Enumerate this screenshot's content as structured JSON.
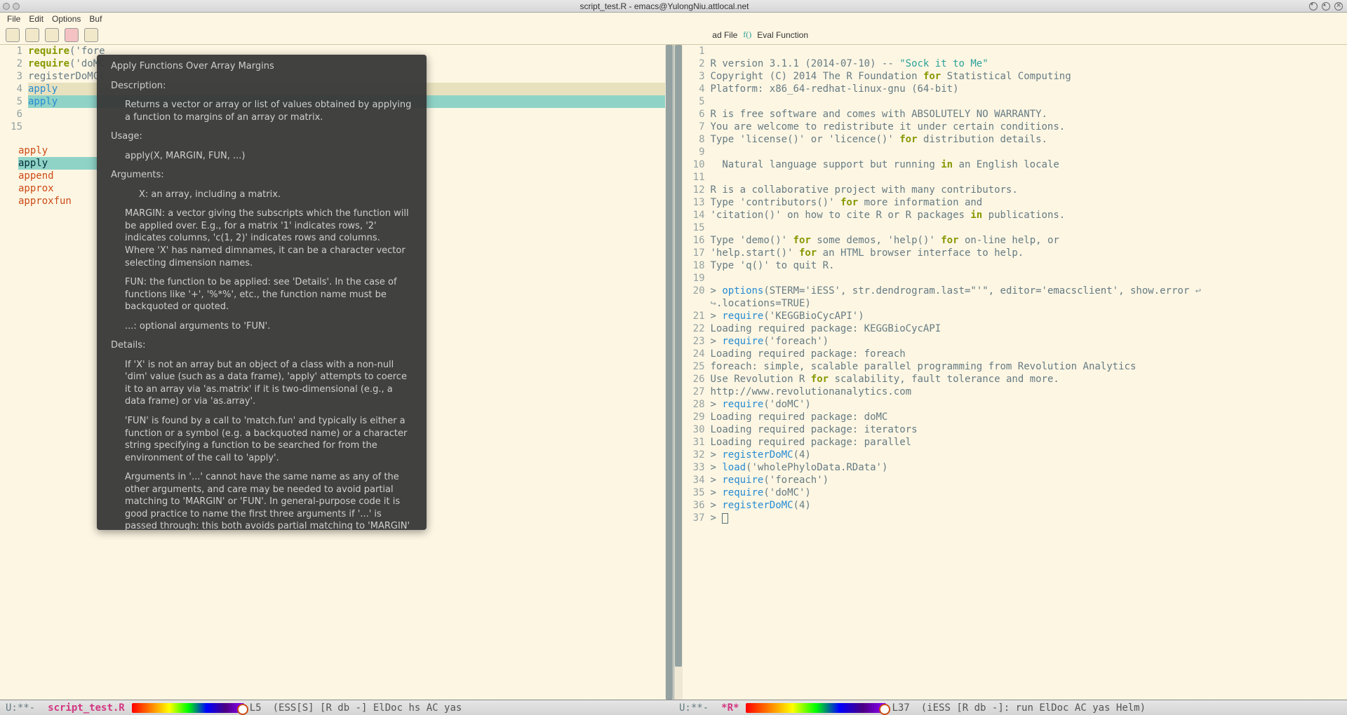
{
  "titlebar": {
    "title": "script_test.R - emacs@YulongNiu.attlocal.net"
  },
  "menu": {
    "items": [
      "File",
      "Edit",
      "Options",
      "Buf"
    ]
  },
  "toolbar": {
    "load_file": "ad File",
    "eval_function": "Eval Function"
  },
  "left": {
    "gutter": [
      "1",
      "2",
      "3",
      "4",
      "5",
      "6",
      "15"
    ],
    "lines": [
      {
        "raw": [
          {
            "t": "require",
            "c": "kw"
          },
          {
            "t": "('fore",
            "c": ""
          }
        ]
      },
      {
        "raw": [
          {
            "t": "require",
            "c": "kw"
          },
          {
            "t": "('doMC",
            "c": ""
          }
        ]
      },
      {
        "raw": [
          {
            "t": "registerDoMC(",
            "c": ""
          }
        ]
      },
      {
        "raw": [
          {
            "t": "",
            "c": ""
          }
        ]
      },
      {
        "raw": [
          {
            "t": "apply",
            "c": "kw2"
          }
        ],
        "hl": true
      },
      {
        "raw": [
          {
            "t": "apply",
            "c": "kw2"
          }
        ],
        "sel": true
      }
    ]
  },
  "completion": {
    "items": [
      {
        "label": "apply"
      },
      {
        "label": "apply",
        "selected": true
      },
      {
        "label": "append"
      },
      {
        "label": "approx"
      },
      {
        "label": "approxfun"
      }
    ]
  },
  "popup": {
    "title": "Apply Functions Over Array Margins",
    "sections": {
      "description_h": "Description:",
      "description": "Returns a vector or array or list of values obtained by applying a function to margins of an array or matrix.",
      "usage_h": "Usage:",
      "usage": "apply(X, MARGIN, FUN, ...)",
      "arguments_h": "Arguments:",
      "arg_x": "X: an array, including a matrix.",
      "arg_margin": "MARGIN: a vector giving the subscripts which the function will be applied over.  E.g., for a matrix '1' indicates rows, '2' indicates columns, 'c(1, 2)' indicates rows and columns. Where 'X' has named dimnames, it can be a character vector selecting dimension names.",
      "arg_fun": "FUN: the function to be applied: see 'Details'.  In the case of functions like '+', '%*%', etc., the function name must be backquoted or quoted.",
      "arg_dots": "...: optional arguments to 'FUN'.",
      "details_h": "Details:",
      "details_1": "If 'X' is not an array but an object of a class with a non-null 'dim' value (such as a data frame), 'apply' attempts to coerce it to an array via 'as.matrix' if it is two-dimensional (e.g., a data frame) or via 'as.array'.",
      "details_2": "'FUN' is found by a call to 'match.fun' and typically is either a function or a symbol (e.g. a backquoted name) or a character string specifying a function to be searched for from the environment of the call to 'apply'.",
      "details_3": "Arguments in '...' cannot have the same name as any of the other arguments, and care may be needed to avoid partial matching to 'MARGIN' or 'FUN'.  In general-purpose code it is good practice to name the first three arguments if '...' is passed through: this both avoids partial matching to 'MARGIN' or 'FUN' and ensures that a sensible error message is given if arguments named 'X', 'MARGIN'"
    }
  },
  "right": {
    "gutter": [
      "1",
      "2",
      "3",
      "4",
      "5",
      "6",
      "7",
      "8",
      "9",
      "10",
      "11",
      "12",
      "13",
      "14",
      "15",
      "16",
      "17",
      "18",
      "19",
      "20",
      "",
      "21",
      "22",
      "23",
      "24",
      "25",
      "26",
      "27",
      "28",
      "29",
      "30",
      "31",
      "32",
      "33",
      "34",
      "35",
      "36",
      "37"
    ],
    "lines": [
      "",
      [
        {
          "t": "R version 3.1.1 (2014-07-10) -- "
        },
        {
          "t": "\"Sock it to Me\"",
          "c": "str"
        }
      ],
      [
        {
          "t": "Copyright (C) 2014 The R Foundation "
        },
        {
          "t": "for",
          "c": "kw"
        },
        {
          "t": " Statistical Computing"
        }
      ],
      [
        {
          "t": "Platform: x86_64-redhat-linux-gnu (64-bit)"
        }
      ],
      "",
      [
        {
          "t": "R is free software and comes with ABSOLUTELY NO WARRANTY."
        }
      ],
      [
        {
          "t": "You are welcome to redistribute it under certain conditions."
        }
      ],
      [
        {
          "t": "Type 'license()' or 'licence()' "
        },
        {
          "t": "for",
          "c": "kw"
        },
        {
          "t": " distribution details."
        }
      ],
      "",
      [
        {
          "t": "  Natural language support but running "
        },
        {
          "t": "in",
          "c": "kw"
        },
        {
          "t": " an English locale"
        }
      ],
      "",
      [
        {
          "t": "R is a collaborative project with many contributors."
        }
      ],
      [
        {
          "t": "Type 'contributors()' "
        },
        {
          "t": "for",
          "c": "kw"
        },
        {
          "t": " more information and"
        }
      ],
      [
        {
          "t": "'citation()' on how to cite R or R packages "
        },
        {
          "t": "in",
          "c": "kw"
        },
        {
          "t": " publications."
        }
      ],
      "",
      [
        {
          "t": "Type 'demo()' "
        },
        {
          "t": "for",
          "c": "kw"
        },
        {
          "t": " some demos, 'help()' "
        },
        {
          "t": "for",
          "c": "kw"
        },
        {
          "t": " on-line help, or"
        }
      ],
      [
        {
          "t": "'help.start()' "
        },
        {
          "t": "for",
          "c": "kw"
        },
        {
          "t": " an HTML browser interface to help."
        }
      ],
      [
        {
          "t": "Type 'q()' to quit R."
        }
      ],
      "",
      [
        {
          "t": "> "
        },
        {
          "t": "options",
          "c": "kw2"
        },
        {
          "t": "(STERM='iESS', str.dendrogram.last=\"'\", editor='emacsclient', show.error "
        },
        {
          "t": "↩",
          "c": "wrap-arrow"
        }
      ],
      [
        {
          "t": "↪",
          "c": "wrap-arrow"
        },
        {
          "t": ".locations=TRUE)"
        }
      ],
      [
        {
          "t": "> "
        },
        {
          "t": "require",
          "c": "kw2"
        },
        {
          "t": "('KEGGBioCycAPI')"
        }
      ],
      [
        {
          "t": "Loading required package: KEGGBioCycAPI"
        }
      ],
      [
        {
          "t": "> "
        },
        {
          "t": "require",
          "c": "kw2"
        },
        {
          "t": "('foreach')"
        }
      ],
      [
        {
          "t": "Loading required package: foreach"
        }
      ],
      [
        {
          "t": "foreach: simple, scalable parallel programming from Revolution Analytics"
        }
      ],
      [
        {
          "t": "Use Revolution R "
        },
        {
          "t": "for",
          "c": "kw"
        },
        {
          "t": " scalability, fault tolerance and more."
        }
      ],
      [
        {
          "t": "http://www.revolutionanalytics.com"
        }
      ],
      [
        {
          "t": "> "
        },
        {
          "t": "require",
          "c": "kw2"
        },
        {
          "t": "('doMC')"
        }
      ],
      [
        {
          "t": "Loading required package: doMC"
        }
      ],
      [
        {
          "t": "Loading required package: iterators"
        }
      ],
      [
        {
          "t": "Loading required package: parallel"
        }
      ],
      [
        {
          "t": "> "
        },
        {
          "t": "registerDoMC",
          "c": "kw2"
        },
        {
          "t": "(4)"
        }
      ],
      [
        {
          "t": "> "
        },
        {
          "t": "load",
          "c": "kw2"
        },
        {
          "t": "('wholePhyloData.RData')"
        }
      ],
      [
        {
          "t": "> "
        },
        {
          "t": "require",
          "c": "kw2"
        },
        {
          "t": "('foreach')"
        }
      ],
      [
        {
          "t": "> "
        },
        {
          "t": "require",
          "c": "kw2"
        },
        {
          "t": "('doMC')"
        }
      ],
      [
        {
          "t": "> "
        },
        {
          "t": "registerDoMC",
          "c": "kw2"
        },
        {
          "t": "(4)"
        }
      ],
      [
        {
          "t": "> "
        },
        {
          "t": "",
          "cursor": true
        }
      ]
    ]
  },
  "modeline": {
    "left": {
      "prefix": "U:**-",
      "buffer": "script_test.R",
      "line": "L5",
      "modes": "(ESS[S] [R db -] ElDoc hs AC yas"
    },
    "right": {
      "prefix": "U:**-",
      "buffer": "*R*",
      "line": "L37",
      "modes": "(iESS [R db -]: run ElDoc AC yas Helm)"
    }
  }
}
